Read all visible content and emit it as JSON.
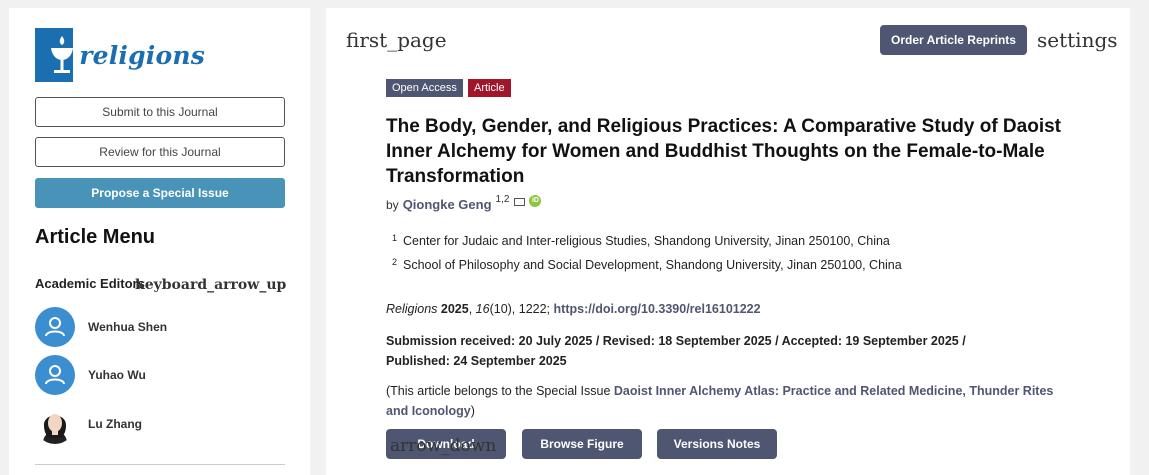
{
  "sidebar": {
    "logo_text": "religions",
    "submit_label": "Submit to this Journal",
    "review_label": "Review for this Journal",
    "propose_label": "Propose a Special Issue",
    "menu_title": "Article Menu",
    "editors_label": "Academic Editors",
    "editors_toggle_icon": "keyboard_arrow_up",
    "editors": [
      {
        "name": "Wenhua Shen",
        "avatar": "person-icon"
      },
      {
        "name": "Yuhao Wu",
        "avatar": "person-icon"
      },
      {
        "name": "Lu Zhang",
        "avatar": "photo"
      }
    ]
  },
  "header": {
    "first_page_label": "first_page",
    "reprints_label": "Order Article Reprints",
    "settings_label": "settings"
  },
  "article": {
    "badge_open_access": "Open Access",
    "badge_type": "Article",
    "title": "The Body, Gender, and Religious Practices: A Comparative Study of Daoist Inner Alchemy for Women and Buddhist Thoughts on the Female-to-Male Transformation",
    "by_label": "by",
    "author": "Qiongke Geng",
    "author_sup": "1,2",
    "affiliations": [
      {
        "num": "1",
        "text": "Center for Judaic and Inter-religious Studies, Shandong University, Jinan 250100, China"
      },
      {
        "num": "2",
        "text": "School of Philosophy and Social Development, Shandong University, Jinan 250100, China"
      }
    ],
    "citation_journal": "Religions",
    "citation_year": "2025",
    "citation_volume": "16",
    "citation_rest": "(10), 1222;",
    "doi": "https://doi.org/10.3390/rel16101222",
    "dates": "Submission received: 20 July 2025 / Revised: 18 September 2025 / Accepted: 19 September 2025 / Published: 24 September 2025",
    "special_prefix": "(This article belongs to the Special Issue",
    "special_link": "Daoist Inner Alchemy Atlas: Practice and Related Medicine, Thunder Rites and Iconology",
    "special_suffix": ")"
  },
  "actions": {
    "download_label": "Download",
    "download_icon_text": "arrow_down",
    "browse_label": "Browse Figure",
    "versions_label": "Versions Notes"
  },
  "colors": {
    "brand_blue": "#1b6fb0",
    "button_dark": "#4f5671",
    "propose_blue": "#4a93b8",
    "article_red": "#a0172b"
  }
}
